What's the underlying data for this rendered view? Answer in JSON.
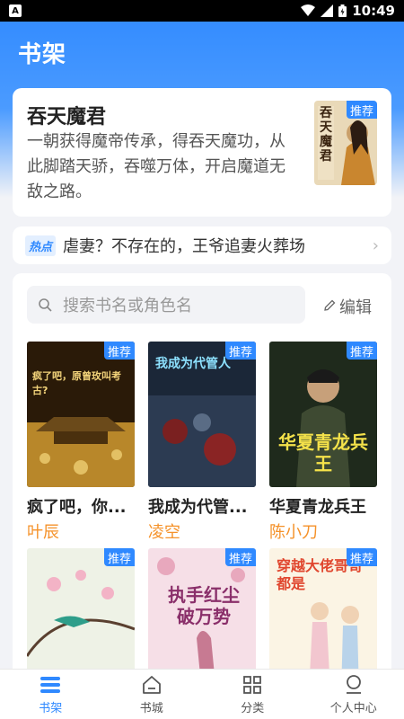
{
  "status_bar": {
    "time": "10:49",
    "app_icon_letter": "A"
  },
  "page": {
    "title": "书架"
  },
  "banner": {
    "title": "吞天魔君",
    "description": "一朝获得魔帝传承，得吞天魔功，从此脚踏天骄，吞噬万体，开启魔道无敌之路。",
    "badge": "推荐",
    "cover_text": "吞天魔君",
    "dot_count": 8,
    "active_dot": 0
  },
  "hot": {
    "badge": "热点",
    "text": "虐妻？不存在的，王爷追妻火葬场",
    "arrow": "›"
  },
  "shelf": {
    "search_placeholder": "搜索书名或角色名",
    "edit_label": "编辑",
    "books": [
      {
        "title": "疯了吧，你...",
        "author": "叶辰",
        "badge": "推荐",
        "cover_text": "疯了吧，原曾玫叫考古?"
      },
      {
        "title": "我成为代管...",
        "author": "凌空",
        "badge": "推荐",
        "cover_text": "我成为代管人"
      },
      {
        "title": "华夏青龙兵王",
        "author": "陈小刀",
        "badge": "推荐",
        "cover_text": "华夏青龙兵王"
      },
      {
        "title": "",
        "author": "",
        "badge": "推荐",
        "cover_text": ""
      },
      {
        "title": "",
        "author": "",
        "badge": "推荐",
        "cover_text": "执手红尘破万势"
      },
      {
        "title": "",
        "author": "",
        "badge": "推荐",
        "cover_text": "穿越大佬哥哥都是"
      }
    ]
  },
  "nav": [
    {
      "label": "书架",
      "icon": "bookshelf-icon",
      "active": true
    },
    {
      "label": "书城",
      "icon": "store-icon",
      "active": false
    },
    {
      "label": "分类",
      "icon": "category-grid-icon",
      "active": false
    },
    {
      "label": "个人中心",
      "icon": "profile-icon",
      "active": false
    }
  ],
  "colors": {
    "accent": "#2f89ff",
    "author": "#f5922a"
  }
}
